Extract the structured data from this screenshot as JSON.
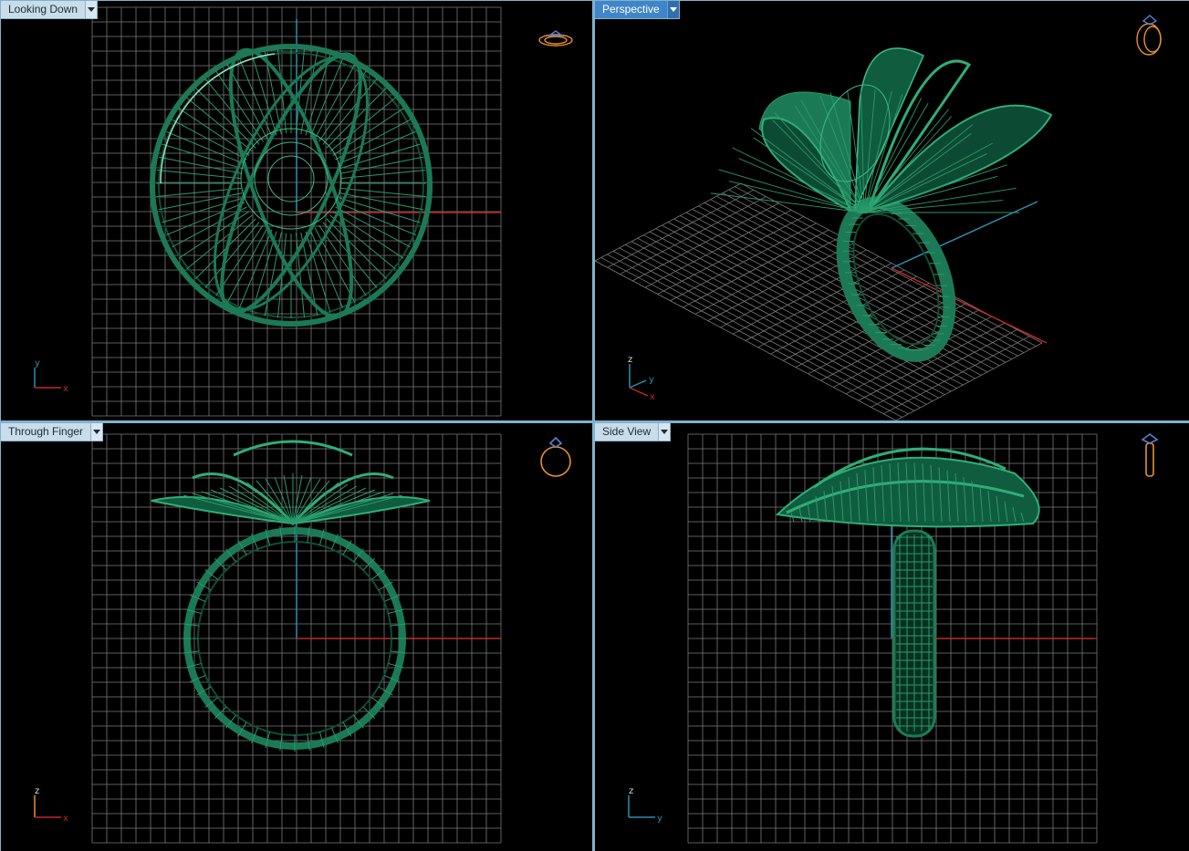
{
  "colors": {
    "background": "#000000",
    "grid": "#7a7a7a",
    "ring": "#1b7a55",
    "ring_highlight": "#6fd0a6",
    "x_axis": "#c0282a",
    "y_axis": "#2a8fb0",
    "icon": "#e8902e",
    "tab_active": "#3f86c9",
    "tab_inactive": "#c9dcea"
  },
  "viewports": [
    {
      "id": "top",
      "label": "Looking Down",
      "active": false,
      "icon": "ring-top-view-icon",
      "axes": [
        "y",
        "x"
      ]
    },
    {
      "id": "perspective",
      "label": "Perspective",
      "active": true,
      "icon": "ring-perspective-icon",
      "axes": [
        "z",
        "y",
        "x"
      ]
    },
    {
      "id": "front",
      "label": "Through Finger",
      "active": false,
      "icon": "ring-front-view-icon",
      "axes": [
        "z",
        "x"
      ]
    },
    {
      "id": "side",
      "label": "Side View",
      "active": false,
      "icon": "ring-side-view-icon",
      "axes": [
        "z",
        "y"
      ]
    }
  ]
}
